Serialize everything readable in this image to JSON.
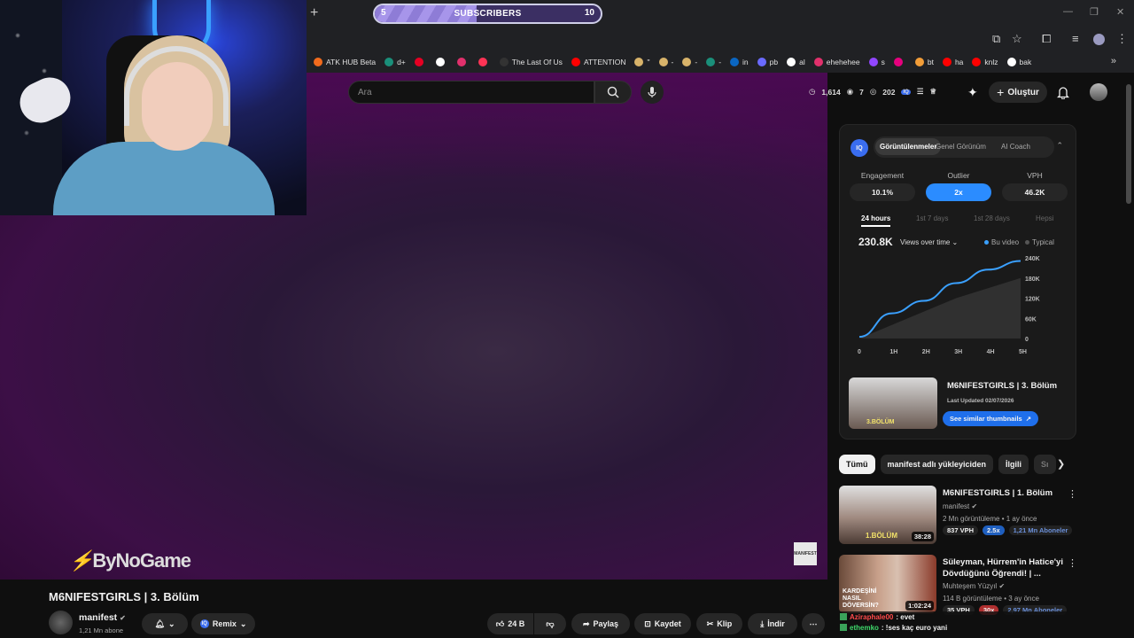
{
  "subscribers_goal": {
    "start": "5",
    "label": "SUBSCRIBERS",
    "end": "10",
    "progress": 0.45
  },
  "bookmarks": [
    {
      "label": "ATK HUB Beta",
      "color": "#f26b1d"
    },
    {
      "label": "d+",
      "color": "#1a8f7a"
    },
    {
      "label": "",
      "color": "#e60023"
    },
    {
      "label": "",
      "color": "#ffffff"
    },
    {
      "label": "",
      "color": "#e1306c"
    },
    {
      "label": "",
      "color": "#ff3355"
    },
    {
      "label": "The Last Of Us",
      "color": "#333333"
    },
    {
      "label": "ATTENTION",
      "color": "#ff0000"
    },
    {
      "label": "\"",
      "color": "#d8b36a"
    },
    {
      "label": "-",
      "color": "#d8b36a"
    },
    {
      "label": "-",
      "color": "#d8b36a"
    },
    {
      "label": "-",
      "color": "#1a8f7a"
    },
    {
      "label": "in",
      "color": "#0a66c2"
    },
    {
      "label": "pb",
      "color": "#6a6aff"
    },
    {
      "label": "al",
      "color": "#ffffff"
    },
    {
      "label": "ehehehee",
      "color": "#e1306c"
    },
    {
      "label": "s",
      "color": "#9146ff"
    },
    {
      "label": "",
      "color": "#e6007e"
    },
    {
      "label": "bt",
      "color": "#f29d38"
    },
    {
      "label": "ha",
      "color": "#ff0000"
    },
    {
      "label": "knlz",
      "color": "#ff0000"
    },
    {
      "label": "bak",
      "color": "#ffffff"
    }
  ],
  "search": {
    "placeholder": "Ara"
  },
  "header_stats": {
    "a": "1,614",
    "b": "7",
    "c": "202"
  },
  "header": {
    "create_label": "Oluştur"
  },
  "iq_panel": {
    "logo": "IQ",
    "tabs": [
      "Görüntülenmeler",
      "Genel Görünüm",
      "AI Coach"
    ],
    "metrics": [
      {
        "label": "Engagement",
        "value": "10.1%"
      },
      {
        "label": "Outlier",
        "value": "2x"
      },
      {
        "label": "VPH",
        "value": "46.2K"
      }
    ],
    "ranges": [
      "24 hours",
      "1st 7 days",
      "1st 28 days",
      "Hepsi"
    ],
    "views": "230.8K",
    "views_dropdown": "Views over time",
    "legend_this": "Bu video",
    "legend_typical": "Typical",
    "video_title": "M6NIFESTGIRLS | 3. Bölüm",
    "last_updated": "Last Updated 02/07/2026",
    "similar_label": "See similar thumbnails",
    "thumb_text": "3.BÖLÜM"
  },
  "chart_data": {
    "type": "area",
    "x": [
      "0",
      "1H",
      "2H",
      "3H",
      "4H",
      "5H"
    ],
    "y_ticks": [
      "0",
      "60K",
      "120K",
      "180K",
      "240K"
    ],
    "ylim": [
      0,
      240000
    ],
    "series": [
      {
        "name": "Bu video",
        "values": [
          5000,
          75000,
          112000,
          165000,
          205000,
          230800
        ]
      },
      {
        "name": "Typical",
        "values": [
          0,
          40000,
          80000,
          120000,
          150000,
          180000
        ]
      }
    ]
  },
  "chips": [
    "Tümü",
    "manifest adlı yükleyiciden",
    "İlgili",
    "Sı"
  ],
  "related": [
    {
      "title": "M6NIFESTGIRLS | 1. Bölüm",
      "channel": "manifest",
      "meta": "2 Mn görüntüleme • 1 ay önce",
      "vph": "837 VPH",
      "outlier": "2.5x",
      "subs": "1,21 Mn Aboneler",
      "duration": "38:28",
      "thumb_text": "1.BÖLÜM"
    },
    {
      "title": "Süleyman, Hürrem'in Hatice'yi Dövdüğünü Öğrendi! | ...",
      "channel": "Muhteşem Yüzyıl",
      "meta": "114 B görüntüleme • 3 ay önce",
      "vph": "35 VPH",
      "outlier": "30x",
      "subs": "2,97 Mn Aboneler",
      "duration": "1:02:24",
      "thumb_text": "KARDEŞİNİ NASIL DÖVERSİN?"
    }
  ],
  "overlay": {
    "brand_a": "By",
    "brand_b": "NoGame",
    "watermark": "MANIFEST"
  },
  "video": {
    "title": "M6NIFESTGIRLS | 3. Bölüm",
    "channel": "manifest",
    "subs": "1,21 Mn abone",
    "remix": "Remix",
    "likes": "24 B",
    "share": "Paylaş",
    "save": "Kaydet",
    "clip": "Klip",
    "download": "İndir"
  },
  "chat": [
    {
      "user": "Aziraphale00",
      "msg": ": evet",
      "user_color": "#ff4b4b"
    },
    {
      "user": "ethemko",
      "msg": ": !ses kaç euro yani",
      "user_color": "#3fd96b"
    }
  ]
}
